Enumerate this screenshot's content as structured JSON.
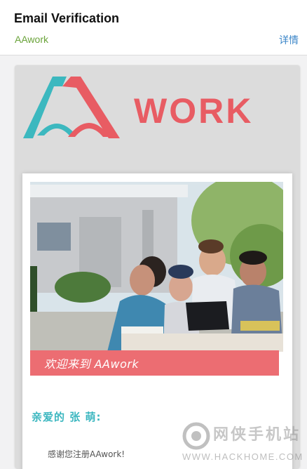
{
  "header": {
    "subject": "Email Verification",
    "sender": "AAwork",
    "details_label": "详情"
  },
  "email": {
    "logo": {
      "text": "WORK",
      "colors": {
        "red": "#e85c63",
        "teal": "#3cb8bf"
      }
    },
    "banner_text": "欢迎来到 AAwork",
    "greeting": "亲爱的 张 萌:",
    "thanks": "感谢您注册AAwork!"
  },
  "watermark": {
    "site_name": "网侠手机站",
    "url": "WWW.HACKHOME.COM"
  }
}
